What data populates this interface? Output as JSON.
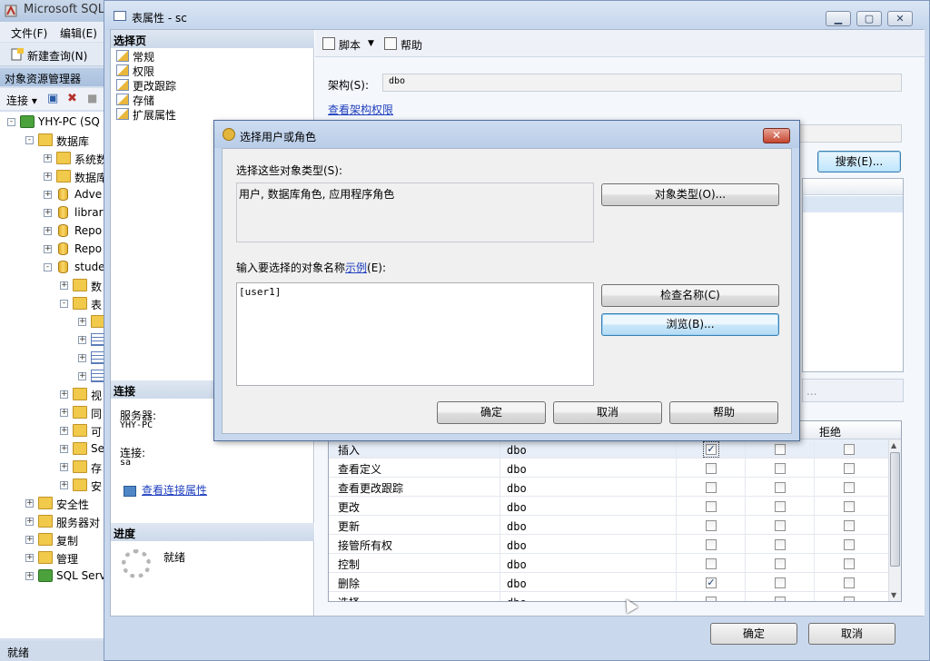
{
  "ssms": {
    "title": "Microsoft SQL",
    "menu": [
      "文件(F)",
      "编辑(E)"
    ],
    "new_query": "新建查询(N)",
    "object_explorer": "对象资源管理器",
    "connect": "连接",
    "status": "就绪",
    "tree": [
      {
        "label": "YHY-PC (SQ",
        "icon": "server"
      },
      {
        "label": "数据库",
        "icon": "folder"
      },
      {
        "label": "系统数",
        "icon": "folder"
      },
      {
        "label": "数据库",
        "icon": "folder"
      },
      {
        "label": "Adve",
        "icon": "database"
      },
      {
        "label": "librar",
        "icon": "database"
      },
      {
        "label": "Repo",
        "icon": "database"
      },
      {
        "label": "Repo",
        "icon": "database"
      },
      {
        "label": "stude",
        "icon": "database"
      },
      {
        "label": "数",
        "icon": "folder"
      },
      {
        "label": "表",
        "icon": "folder"
      },
      {
        "label": "",
        "icon": "folder"
      },
      {
        "label": "",
        "icon": "table"
      },
      {
        "label": "",
        "icon": "table"
      },
      {
        "label": "",
        "icon": "table"
      },
      {
        "label": "视",
        "icon": "folder"
      },
      {
        "label": "同",
        "icon": "folder"
      },
      {
        "label": "可",
        "icon": "folder"
      },
      {
        "label": "Se",
        "icon": "folder"
      },
      {
        "label": "存",
        "icon": "folder"
      },
      {
        "label": "安",
        "icon": "folder"
      },
      {
        "label": "安全性",
        "icon": "folder"
      },
      {
        "label": "服务器对",
        "icon": "folder"
      },
      {
        "label": "复制",
        "icon": "folder"
      },
      {
        "label": "管理",
        "icon": "folder"
      },
      {
        "label": "SQL Serv",
        "icon": "agent"
      }
    ]
  },
  "table_props": {
    "title": "表属性 - sc",
    "select_page": "选择页",
    "pages": [
      "常规",
      "权限",
      "更改跟踪",
      "存储",
      "扩展属性"
    ],
    "toolbar_script": "脚本",
    "toolbar_help": "帮助",
    "schema_label": "架构(S):",
    "schema_value": "dbo",
    "view_schema_perms": "查看架构权限",
    "search_button": "搜索(E)...",
    "explicit_placeholder": "...",
    "connection_header": "连接",
    "server_label": "服务器:",
    "server_value": "YHY-PC",
    "connect_label": "连接:",
    "connect_value": "sa",
    "view_conn_props": "查看连接属性",
    "progress_header": "进度",
    "progress_status": "就绪",
    "deny_header": "拒绝",
    "perm_rows": [
      {
        "name": "插入",
        "grantor": "dbo",
        "grant": true,
        "with_grant": false,
        "deny": false
      },
      {
        "name": "查看定义",
        "grantor": "dbo",
        "grant": false,
        "with_grant": false,
        "deny": false
      },
      {
        "name": "查看更改跟踪",
        "grantor": "dbo",
        "grant": false,
        "with_grant": false,
        "deny": false
      },
      {
        "name": "更改",
        "grantor": "dbo",
        "grant": false,
        "with_grant": false,
        "deny": false
      },
      {
        "name": "更新",
        "grantor": "dbo",
        "grant": false,
        "with_grant": false,
        "deny": false
      },
      {
        "name": "接管所有权",
        "grantor": "dbo",
        "grant": false,
        "with_grant": false,
        "deny": false
      },
      {
        "name": "控制",
        "grantor": "dbo",
        "grant": false,
        "with_grant": false,
        "deny": false
      },
      {
        "name": "删除",
        "grantor": "dbo",
        "grant": true,
        "with_grant": false,
        "deny": false
      },
      {
        "name": "选择",
        "grantor": "dbo",
        "grant": false,
        "with_grant": false,
        "deny": false
      }
    ],
    "ok": "确定",
    "cancel": "取消"
  },
  "select_dialog": {
    "title": "选择用户或角色",
    "object_types_label": "选择这些对象类型(S):",
    "object_types_value": "用户, 数据库角色, 应用程序角色",
    "object_types_button": "对象类型(O)...",
    "names_label": "输入要选择的对象名称",
    "examples_link": "示例",
    "names_label_suffix": "(E):",
    "names_value": "[user1]",
    "check_names_button": "检查名称(C)",
    "browse_button": "浏览(B)...",
    "ok": "确定",
    "cancel": "取消",
    "help": "帮助"
  }
}
